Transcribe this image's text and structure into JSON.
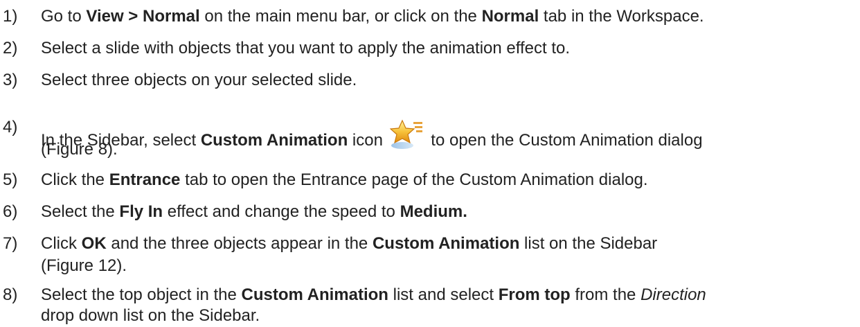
{
  "steps": [
    {
      "num": "1)",
      "lines": [
        [
          {
            "t": "Go to ",
            "s": "n"
          },
          {
            "t": "View > Normal",
            "s": "b"
          },
          {
            "t": " on the main menu bar, or click on the ",
            "s": "n"
          },
          {
            "t": "Normal",
            "s": "b"
          },
          {
            "t": " tab in the Workspace.",
            "s": "n"
          }
        ]
      ]
    },
    {
      "num": "2)",
      "lines": [
        [
          {
            "t": "Select a slide with objects that you want to apply the animation effect to.",
            "s": "n"
          }
        ]
      ]
    },
    {
      "num": "3)",
      "lines": [
        [
          {
            "t": "Select three objects on your selected slide.",
            "s": "n"
          }
        ]
      ]
    },
    {
      "num": "4)",
      "lines": [
        [
          {
            "t": "In the Sidebar, select ",
            "s": "n"
          },
          {
            "t": "Custom Animation",
            "s": "b"
          },
          {
            "t": " icon ",
            "s": "n"
          },
          {
            "icon": "custom-animation-star-icon"
          },
          {
            "t": " to open the Custom Animation dialog",
            "s": "n"
          }
        ],
        [
          {
            "t": "(Figure 8).",
            "s": "n"
          }
        ]
      ]
    },
    {
      "num": "5)",
      "lines": [
        [
          {
            "t": "Click the ",
            "s": "n"
          },
          {
            "t": "Entrance",
            "s": "b"
          },
          {
            "t": " tab to open the Entrance page of the Custom Animation dialog.",
            "s": "n"
          }
        ]
      ]
    },
    {
      "num": "6)",
      "lines": [
        [
          {
            "t": "Select the ",
            "s": "n"
          },
          {
            "t": "Fly In",
            "s": "b"
          },
          {
            "t": " effect and change the speed to ",
            "s": "n"
          },
          {
            "t": "Medium.",
            "s": "b"
          }
        ]
      ]
    },
    {
      "num": "7)",
      "lines": [
        [
          {
            "t": "Click ",
            "s": "n"
          },
          {
            "t": "OK",
            "s": "b"
          },
          {
            "t": " and the three objects appear in the ",
            "s": "n"
          },
          {
            "t": "Custom Animation",
            "s": "b"
          },
          {
            "t": " list on the Sidebar",
            "s": "n"
          }
        ],
        [
          {
            "t": "(Figure 12).",
            "s": "n"
          }
        ]
      ]
    },
    {
      "num": "8)",
      "lines": [
        [
          {
            "t": "Select the top object in the ",
            "s": "n"
          },
          {
            "t": "Custom Animation",
            "s": "b"
          },
          {
            "t": " list and select ",
            "s": "n"
          },
          {
            "t": "From top",
            "s": "b"
          },
          {
            "t": " from the ",
            "s": "n"
          },
          {
            "t": "Direction",
            "s": "i"
          }
        ],
        [
          {
            "t": "drop down list on the Sidebar.",
            "s": "n"
          }
        ]
      ]
    }
  ]
}
